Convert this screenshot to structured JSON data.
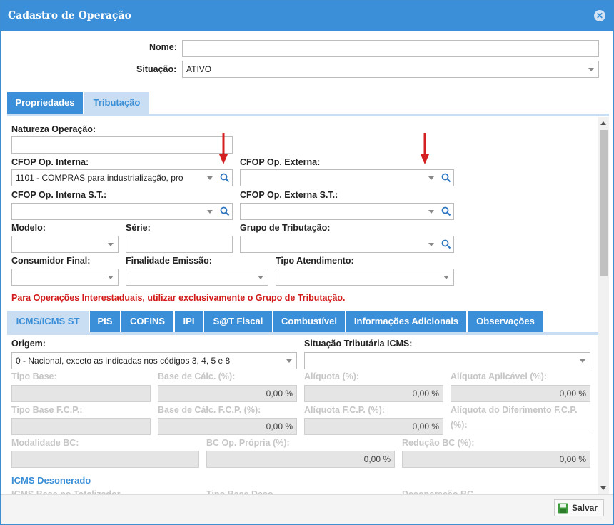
{
  "window": {
    "title": "Cadastro de Operação"
  },
  "header": {
    "nome_label": "Nome:",
    "nome_value": "",
    "situacao_label": "Situação:",
    "situacao_value": "ATIVO"
  },
  "main_tabs": [
    {
      "label": "Propriedades",
      "active": false
    },
    {
      "label": "Tributação",
      "active": true
    }
  ],
  "form": {
    "natureza_label": "Natureza Operação:",
    "natureza_value": "",
    "cfop_interna_label": "CFOP Op. Interna:",
    "cfop_interna_value": "1101 - COMPRAS para industrialização, pro",
    "cfop_externa_label": "CFOP Op. Externa:",
    "cfop_externa_value": "",
    "cfop_interna_st_label": "CFOP Op. Interna S.T.:",
    "cfop_externa_st_label": "CFOP Op. Externa S.T.:",
    "modelo_label": "Modelo:",
    "serie_label": "Série:",
    "grupo_label": "Grupo de Tributação:",
    "consumidor_label": "Consumidor Final:",
    "finalidade_label": "Finalidade Emissão:",
    "tipo_atendimento_label": "Tipo Atendimento:",
    "warning": "Para Operações Interestaduais, utilizar exclusivamente o Grupo de Tributação."
  },
  "sub_tabs": [
    {
      "label": "ICMS/ICMS ST",
      "active": true
    },
    {
      "label": "PIS",
      "active": false
    },
    {
      "label": "COFINS",
      "active": false
    },
    {
      "label": "IPI",
      "active": false
    },
    {
      "label": "S@T Fiscal",
      "active": false
    },
    {
      "label": "Combustível",
      "active": false
    },
    {
      "label": "Informações Adicionais",
      "active": false
    },
    {
      "label": "Observações",
      "active": false
    }
  ],
  "icms": {
    "origem_label": "Origem:",
    "origem_value": "0 - Nacional, exceto as indicadas nos códigos 3, 4, 5 e 8",
    "situacao_trib_label": "Situação Tributária ICMS:",
    "tipo_base_label": "Tipo Base:",
    "base_calc_label": "Base de Cálc. (%):",
    "base_calc_value": "0,00 %",
    "aliquota_label": "Alíquota (%):",
    "aliquota_value": "0,00 %",
    "aliquota_aplicavel_label": "Alíquota Aplicável (%):",
    "aliquota_aplicavel_value": "0,00 %",
    "tipo_base_fcp_label": "Tipo Base F.C.P.:",
    "base_calc_fcp_label": "Base de Cálc. F.C.P. (%):",
    "base_calc_fcp_value": "0,00 %",
    "aliquota_fcp_label": "Alíquota F.C.P. (%):",
    "aliquota_fcp_value": "0,00 %",
    "aliquota_dif_fcp_label": "Alíquota do Diferimento F.C.P.",
    "aliquota_dif_fcp_label2": "(%):",
    "modalidade_label": "Modalidade BC:",
    "bc_propria_label": "BC Op. Própria (%):",
    "bc_propria_value": "0,00 %",
    "reducao_label": "Redução BC (%):",
    "reducao_value": "0,00 %",
    "desonerado_title": "ICMS Desonerado",
    "cut_1": "ICMS Base no Totalizador",
    "cut_2": "Tipo Base Deso",
    "cut_3": "Desoneração BC"
  },
  "footer": {
    "save_label": "Salvar"
  },
  "colors": {
    "accent": "#3a8fd8",
    "warning": "#d21a1a",
    "arrow": "#d42020"
  }
}
